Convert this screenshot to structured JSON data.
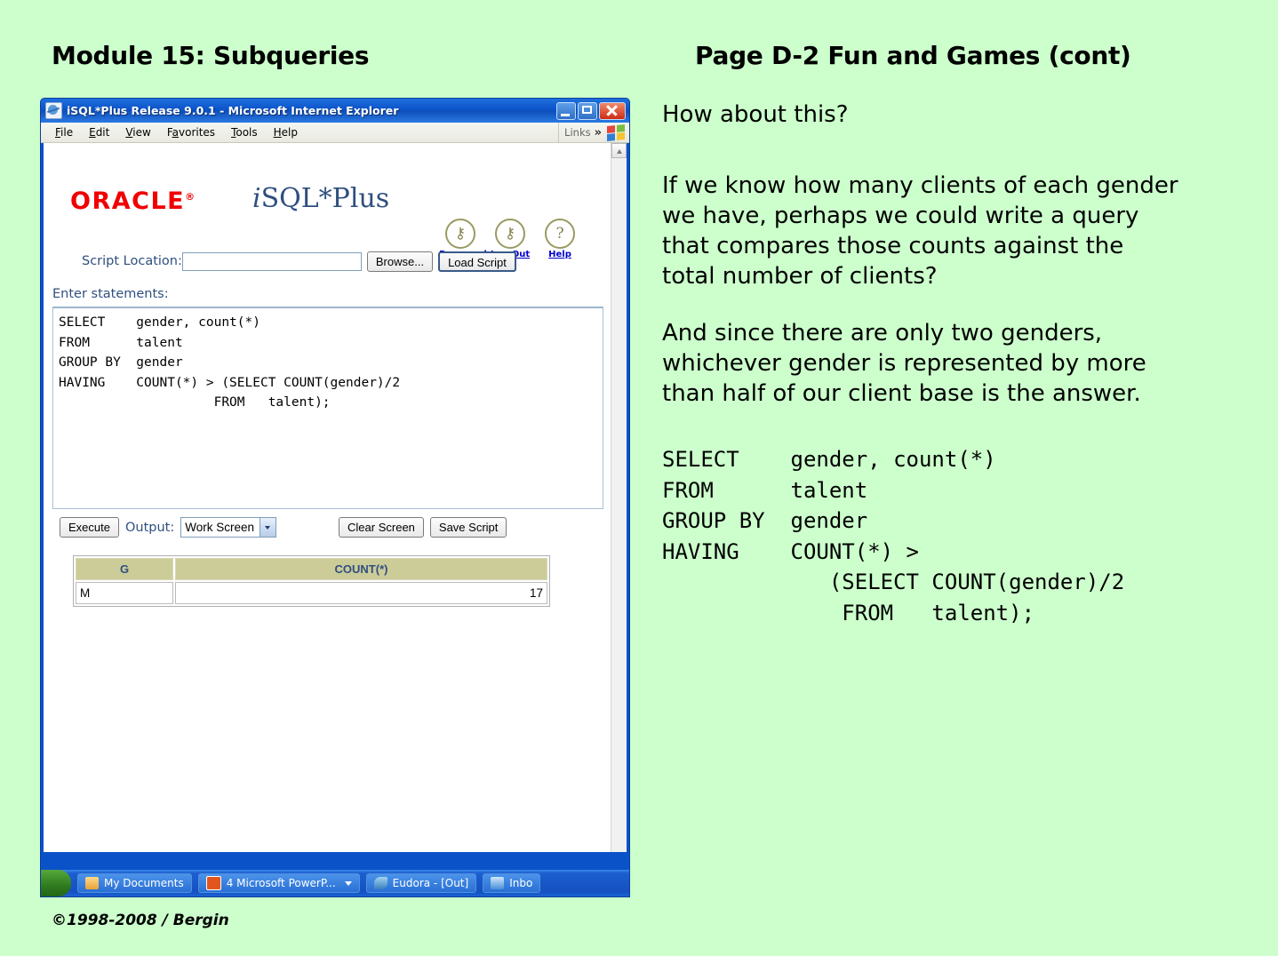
{
  "slide": {
    "header_left": "Module 15: Subqueries",
    "header_right": "Page D-2  Fun and Games (cont)",
    "footer": "©1998-2008 / Bergin",
    "background_color": "#ccffcc"
  },
  "browser": {
    "title": "iSQL*Plus Release 9.0.1 - Microsoft Internet Explorer",
    "app_icon": "ie-document-icon",
    "window_buttons": {
      "minimize": "minimize-icon",
      "maximize": "maximize-icon",
      "close": "close-icon"
    },
    "menu": [
      "File",
      "Edit",
      "View",
      "Favorites",
      "Tools",
      "Help"
    ],
    "links_label": "Links",
    "links_chevron": "»"
  },
  "page": {
    "logo_text": "ORACLE",
    "logo_mark": "®",
    "logo_color": "#f00000",
    "app_title_italic": "i",
    "app_title_rest": "SQL*Plus",
    "icon_links": [
      {
        "label": "Password",
        "icon": "password-icon",
        "glyph": "⚷"
      },
      {
        "label": "Log Out",
        "icon": "logout-key-icon",
        "glyph": "⚷"
      },
      {
        "label": "Help",
        "icon": "help-question-icon",
        "glyph": "?"
      }
    ],
    "script_location_label": "Script Location:",
    "script_location_value": "",
    "script_location_placeholder": "",
    "browse_button": "Browse...",
    "load_script_button": "Load Script",
    "enter_statements_label": "Enter statements:",
    "sql_text": "SELECT    gender, count(*)\nFROM      talent\nGROUP BY  gender\nHAVING    COUNT(*) > (SELECT COUNT(gender)/2\n                    FROM   talent);",
    "execute_button": "Execute",
    "output_label": "Output:",
    "output_select_value": "Work Screen",
    "output_select_options": [
      "Work Screen"
    ],
    "clear_screen_button": "Clear Screen",
    "save_script_button": "Save Script",
    "results": {
      "columns": [
        "G",
        "COUNT(*)"
      ],
      "rows": [
        [
          "M",
          "17"
        ]
      ],
      "header_bg": "#cccc99",
      "header_text_color": "#2f4f7f"
    }
  },
  "taskbar": {
    "start_label": "",
    "items": [
      {
        "label": "My Documents",
        "icon": "folder-icon",
        "has_arrow": false
      },
      {
        "label": "4 Microsoft PowerP...",
        "icon": "powerpoint-icon",
        "has_arrow": true
      },
      {
        "label": "Eudora - [Out]",
        "icon": "eudora-icon",
        "has_arrow": false
      },
      {
        "label": "Inbo",
        "icon": "inbox-icon",
        "has_arrow": false
      }
    ]
  },
  "notes": {
    "paragraph_1": "How about this?",
    "paragraph_2": "If we know how many clients of each gender\nwe have, perhaps we could write a query\nthat compares those counts against the\ntotal number of clients?",
    "paragraph_3": "And since there are only two genders,\nwhichever gender is represented by more\nthan half of our client base is the answer.",
    "code": "SELECT    gender, count(*)\nFROM      talent\nGROUP BY  gender\nHAVING    COUNT(*) >\n             (SELECT COUNT(gender)/2\n              FROM   talent);"
  }
}
